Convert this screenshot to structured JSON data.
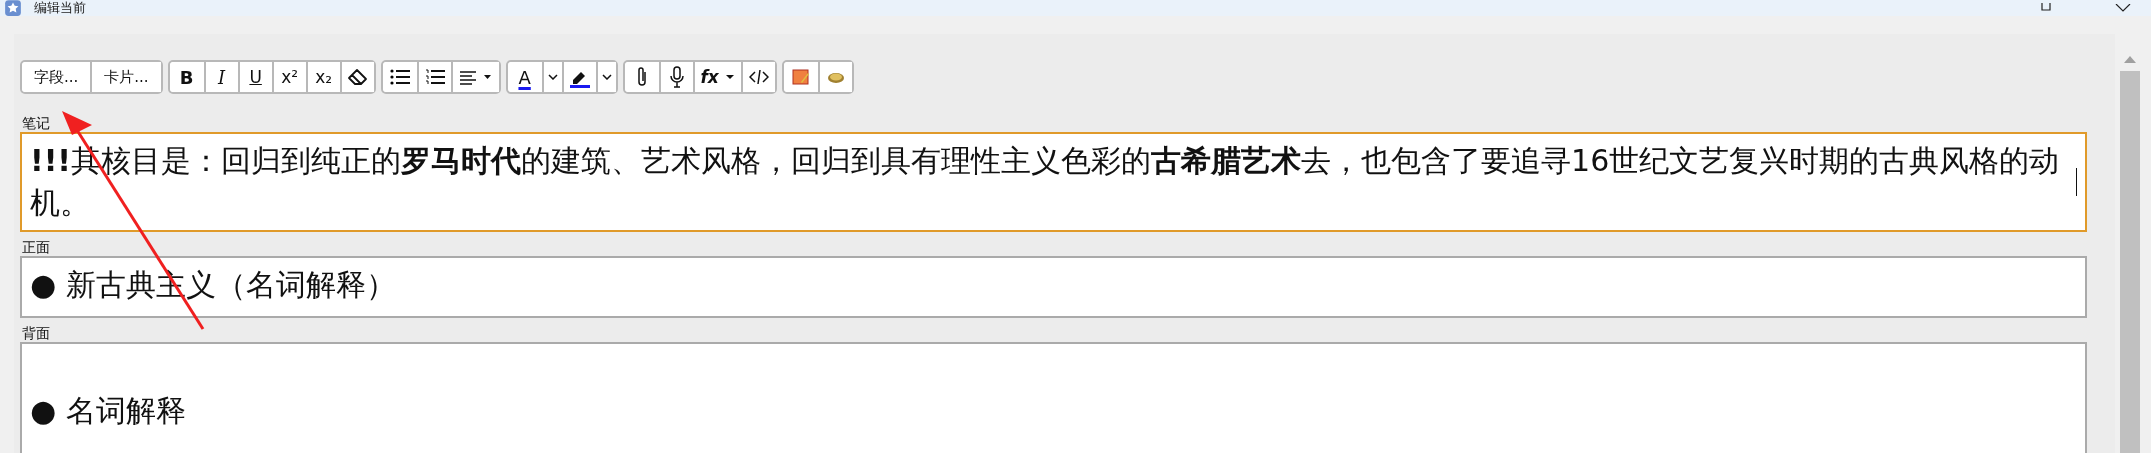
{
  "window": {
    "title": "编辑当前"
  },
  "toolbar": {
    "field_button": "字段...",
    "card_button": "卡片...",
    "format_buttons": [
      "B",
      "I",
      "U",
      "x²",
      "x₂"
    ],
    "text_color_label": "A",
    "function_label": "fx"
  },
  "fields": [
    {
      "label": "笔记",
      "focused": true,
      "cursor": true,
      "leading_blank": false,
      "lines": [
        "**!!!**其核目是：回归到纯正的**罗马时代**的建筑、艺术风格，回归到具有理性主义色彩的**古希腊艺术**去，也包含了要追寻16世纪文艺复兴时期的古典风格的动机。"
      ]
    },
    {
      "label": "正面",
      "focused": false,
      "cursor": false,
      "leading_blank": false,
      "lines": [
        "● 新古典主义（名词解释）"
      ]
    },
    {
      "label": "背面",
      "focused": false,
      "cursor": false,
      "leading_blank": true,
      "lines": [
        "● 名词解释"
      ]
    }
  ]
}
